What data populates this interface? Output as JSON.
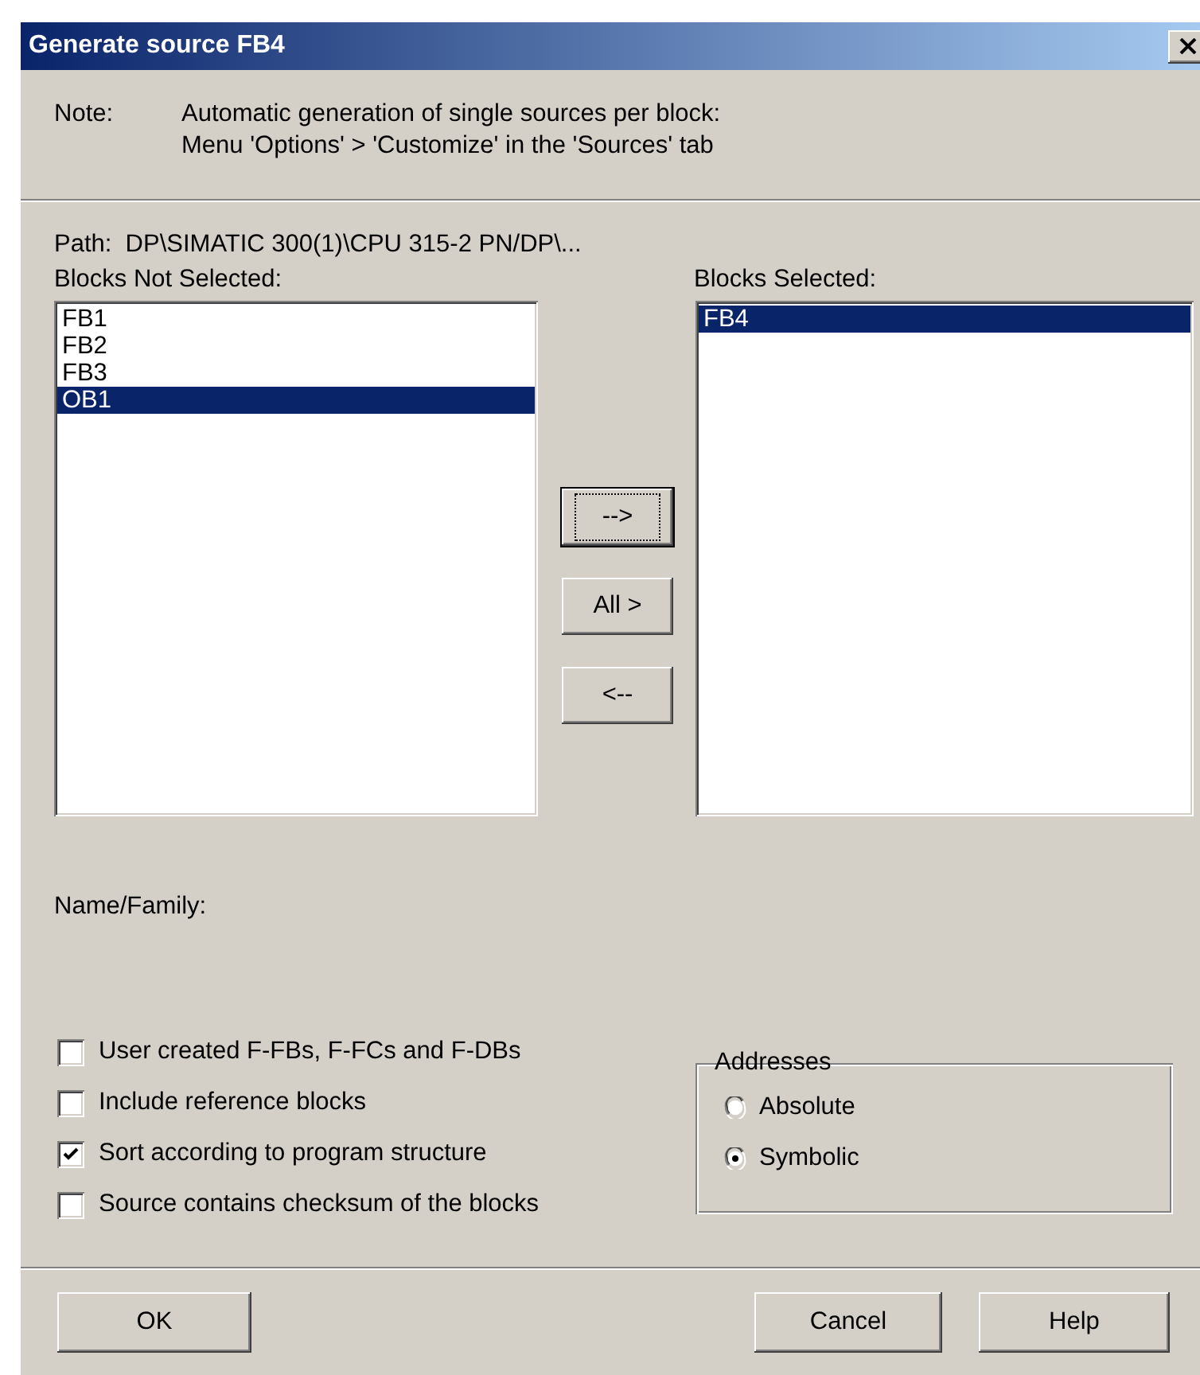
{
  "window": {
    "title": "Generate source FB4"
  },
  "note": {
    "label": "Note:",
    "lines": [
      "Automatic generation of single sources per block:",
      "Menu 'Options' > 'Customize' in the 'Sources' tab"
    ]
  },
  "path": "Path:  DP\\SIMATIC 300(1)\\CPU 315-2 PN/DP\\...",
  "blocks_not_selected": {
    "label": "Blocks Not Selected:",
    "items": [
      {
        "text": "FB1",
        "selected": false
      },
      {
        "text": "FB2",
        "selected": false
      },
      {
        "text": "FB3",
        "selected": false
      },
      {
        "text": "OB1",
        "selected": true
      }
    ]
  },
  "move_buttons": [
    {
      "label": "-->",
      "focused": true
    },
    {
      "label": "All >",
      "focused": false
    },
    {
      "label": "<--",
      "focused": false
    }
  ],
  "blocks_selected": {
    "label": "Blocks Selected:",
    "items": [
      {
        "text": "FB4",
        "selected": true
      }
    ]
  },
  "name_family": "Name/Family:",
  "options": [
    {
      "label": "User created F-FBs, F-FCs and F-DBs",
      "checked": false
    },
    {
      "label": "Include reference blocks",
      "checked": false
    },
    {
      "label": "Sort according to program structure",
      "checked": true
    },
    {
      "label": "Source contains checksum of the blocks",
      "checked": false
    }
  ],
  "addresses": {
    "title": "Addresses",
    "options": [
      {
        "label": "Absolute",
        "selected": false
      },
      {
        "label": "Symbolic",
        "selected": true
      }
    ]
  },
  "buttons": [
    {
      "label": "OK",
      "focused": false
    },
    {
      "label": "Cancel",
      "focused": false
    },
    {
      "label": "Help",
      "focused": false
    }
  ]
}
